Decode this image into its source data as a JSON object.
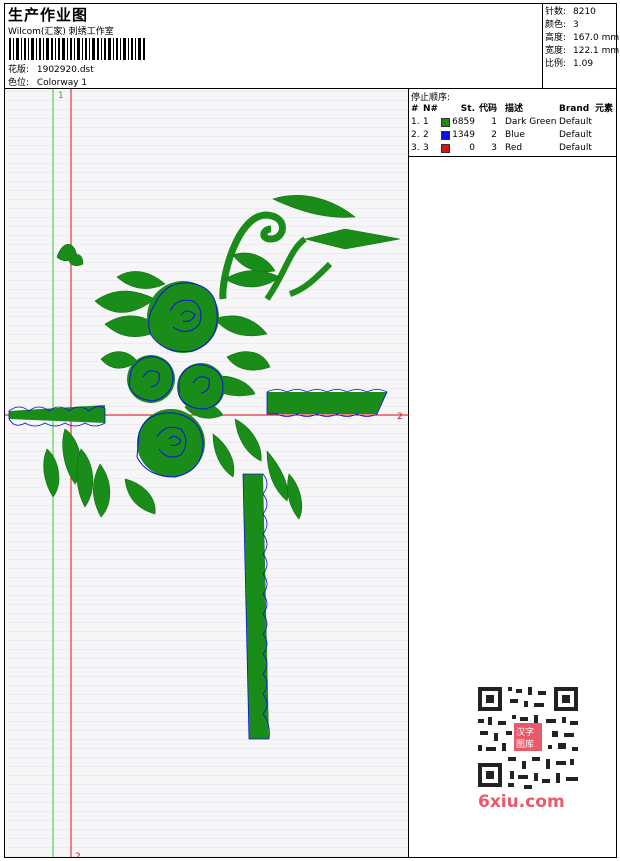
{
  "header": {
    "title": "生产作业图",
    "studio": "Wilcom(汇家) 刺绣工作室",
    "design_label": "花版:",
    "design_value": "1902920.dst",
    "colorway_label": "色位:",
    "colorway_value": "Colorway 1"
  },
  "stats": [
    {
      "label": "针数:",
      "value": "8210"
    },
    {
      "label": "颜色:",
      "value": "3"
    },
    {
      "label": "高度:",
      "value": "167.0 mm"
    },
    {
      "label": "宽度:",
      "value": "122.1 mm"
    },
    {
      "label": "比例:",
      "value": "1.09"
    }
  ],
  "guides": {
    "green_label": "1",
    "red_label_h": "2",
    "red_label_v": "2"
  },
  "stop_sequence": {
    "title": "停止顺序:",
    "headers": {
      "num": "#",
      "no": "N#",
      "st": "St.",
      "code": "代码",
      "desc": "描述",
      "brand": "Brand",
      "element": "元素"
    },
    "rows": [
      {
        "num": "1.",
        "no": "1",
        "color": "#1a8c1a",
        "st": "6859",
        "code": "1",
        "desc": "Dark Green",
        "brand": "Default"
      },
      {
        "num": "2.",
        "no": "2",
        "color": "#1010e0",
        "st": "1349",
        "code": "2",
        "desc": "Blue",
        "brand": "Default"
      },
      {
        "num": "3.",
        "no": "3",
        "color": "#e01010",
        "st": "0",
        "code": "3",
        "desc": "Red",
        "brand": "Default"
      }
    ]
  },
  "watermark": {
    "text": "6xiu.com",
    "stamp": "汉字图库"
  },
  "colors": {
    "green": "#1a8c1a",
    "blue": "#1010e0",
    "red": "#e01010",
    "guide_green": "#33cc33"
  }
}
